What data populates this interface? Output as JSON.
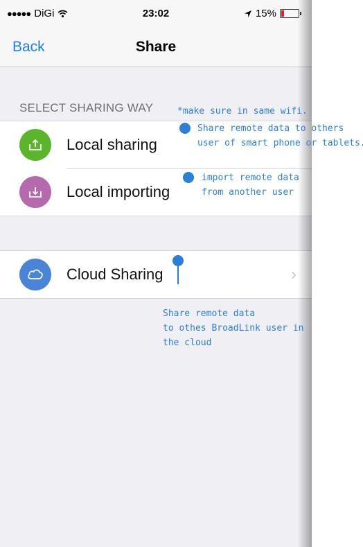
{
  "status_bar": {
    "carrier": "DiGi",
    "time": "23:02",
    "battery": "15%"
  },
  "nav": {
    "back_label": "Back",
    "title": "Share"
  },
  "section_header": "SELECT SHARING WAY",
  "rows": [
    {
      "label": "Local sharing",
      "icon": "upload-tray-icon",
      "color": "#5ab52b"
    },
    {
      "label": "Local importing",
      "icon": "download-tray-icon",
      "color": "#b46aad"
    },
    {
      "label": "Cloud Sharing",
      "icon": "cloud-icon",
      "color": "#4a84d6"
    }
  ],
  "annotations": {
    "wifi_note": "*make sure in same wifi.",
    "share_note": "Share remote data to others\nuser of smart phone or tablets.",
    "import_note": "import remote data\nfrom another user",
    "cloud_note": "Share remote data\nto othes BroadLink user in\nthe cloud",
    "color": "#2b7fd6"
  }
}
